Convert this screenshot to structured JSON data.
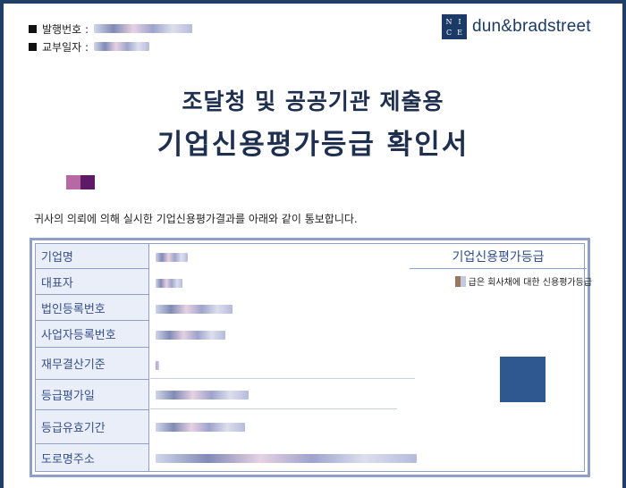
{
  "header": {
    "issue_number_label": "발행번호 :",
    "issue_date_label": "교부일자 :"
  },
  "logo": {
    "box_letters": [
      "N",
      "I",
      "C",
      "E"
    ],
    "brand_text": "dun&bradstreet"
  },
  "titles": {
    "line1": "조달청 및 공공기관 제출용",
    "line2": "기업신용평가등급 확인서"
  },
  "intro_text": "귀사의 의뢰에 의해 실시한 기업신용평가결과를 아래와 같이 통보합니다.",
  "table": {
    "rows": [
      {
        "label": "기업명"
      },
      {
        "label": "대표자"
      },
      {
        "label": "법인등록번호"
      },
      {
        "label": "사업자등록번호"
      },
      {
        "label": "재무결산기준"
      },
      {
        "label": "등급평가일"
      },
      {
        "label": "등급유효기간"
      },
      {
        "label": "도로명주소"
      }
    ],
    "grade_header": "기업신용평가등급",
    "grade_note": "급은 회사채에 대한 신용평가등급"
  },
  "colors": {
    "frame": "#1f3f66",
    "title": "#1f2f4f",
    "label_text": "#36508a",
    "grade_box": "#2f5790"
  }
}
